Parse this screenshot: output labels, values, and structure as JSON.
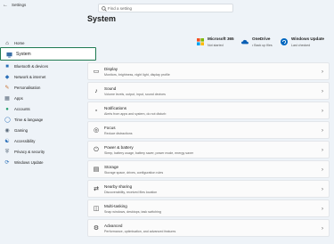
{
  "window": {
    "title": "Settings"
  },
  "search": {
    "placeholder": "Find a setting"
  },
  "page": {
    "title": "System"
  },
  "services": [
    {
      "name": "Microsoft 365",
      "status": "Not started"
    },
    {
      "name": "OneDrive",
      "status": "• Back up files"
    },
    {
      "name": "Windows Update",
      "status": "Last checked"
    }
  ],
  "sidebar": {
    "items": [
      {
        "label": "Home",
        "icon": "home-icon"
      },
      {
        "label": "System",
        "icon": "system-icon",
        "selected": true
      },
      {
        "label": "Bluetooth & devices",
        "icon": "bluetooth-icon"
      },
      {
        "label": "Network & internet",
        "icon": "network-icon"
      },
      {
        "label": "Personalisation",
        "icon": "brush-icon"
      },
      {
        "label": "Apps",
        "icon": "apps-icon"
      },
      {
        "label": "Accounts",
        "icon": "account-icon"
      },
      {
        "label": "Time & language",
        "icon": "globe-icon"
      },
      {
        "label": "Gaming",
        "icon": "gamepad-icon"
      },
      {
        "label": "Accessibility",
        "icon": "accessibility-icon"
      },
      {
        "label": "Privacy & security",
        "icon": "shield-icon"
      },
      {
        "label": "Windows Update",
        "icon": "update-icon"
      }
    ]
  },
  "cards": [
    {
      "title": "Display",
      "subtitle": "Monitors, brightness, night light, display profile",
      "icon": "display-icon"
    },
    {
      "title": "Sound",
      "subtitle": "Volume levels, output, input, sound devices",
      "icon": "speaker-icon"
    },
    {
      "title": "Notifications",
      "subtitle": "Alerts from apps and system, do not disturb",
      "icon": "bell-icon"
    },
    {
      "title": "Focus",
      "subtitle": "Reduce distractions",
      "icon": "focus-icon"
    },
    {
      "title": "Power & battery",
      "subtitle": "Sleep, battery usage, battery saver, power mode, energy saver",
      "icon": "power-icon"
    },
    {
      "title": "Storage",
      "subtitle": "Storage space, drives, configuration rules",
      "icon": "storage-icon"
    },
    {
      "title": "Nearby sharing",
      "subtitle": "Discoverability, received files location",
      "icon": "share-icon"
    },
    {
      "title": "Multi-tasking",
      "subtitle": "Snap windows, desktops, task switching",
      "icon": "multitask-icon"
    },
    {
      "title": "Advanced",
      "subtitle": "Performance, optimisation, and advanced features",
      "icon": "advanced-icon"
    }
  ],
  "colors": {
    "accent": "#1f7a52",
    "background": "#eef3f8",
    "card": "#fbfbfb"
  }
}
